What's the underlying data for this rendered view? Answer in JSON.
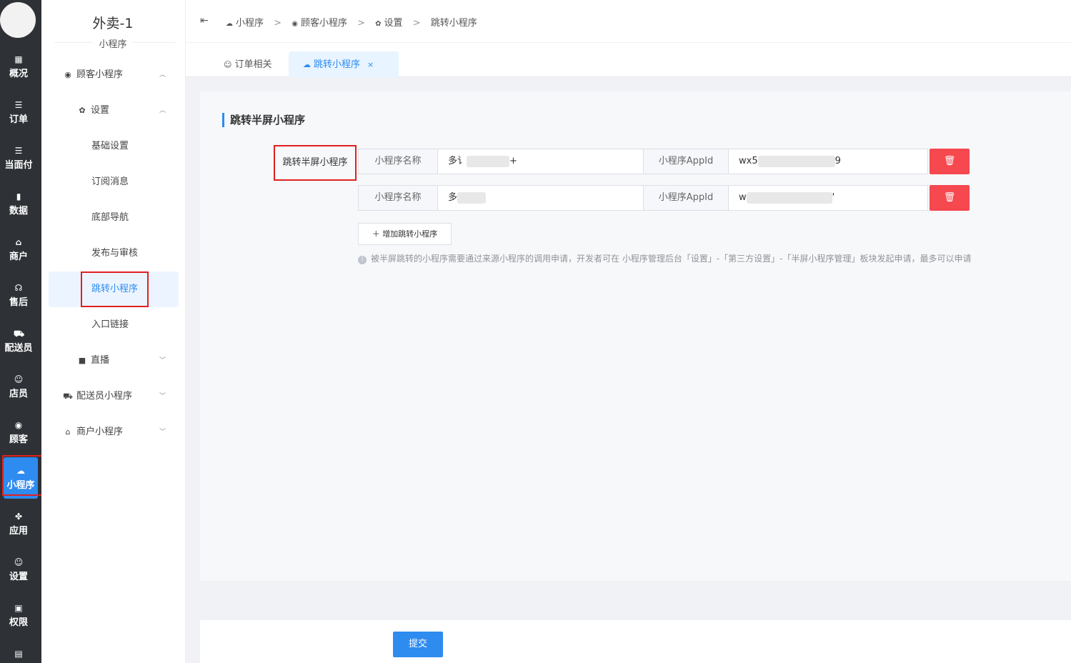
{
  "rail": {
    "items": [
      {
        "label": "概况",
        "icon": "dashboard-icon",
        "glyph": "▦"
      },
      {
        "label": "订单",
        "icon": "list-icon",
        "glyph": "☰"
      },
      {
        "label": "当面付",
        "icon": "list-icon",
        "glyph": "☰"
      },
      {
        "label": "数据",
        "icon": "bar-chart-icon",
        "glyph": "▮"
      },
      {
        "label": "商户",
        "icon": "store-icon",
        "glyph": "⌂"
      },
      {
        "label": "售后",
        "icon": "headset-icon",
        "glyph": "☊"
      },
      {
        "label": "配送员",
        "icon": "scooter-icon",
        "glyph": "⛟"
      },
      {
        "label": "店员",
        "icon": "user-icon",
        "glyph": "☺"
      },
      {
        "label": "顾客",
        "icon": "user-circle-icon",
        "glyph": "◉"
      },
      {
        "label": "小程序",
        "icon": "wechat-icon",
        "glyph": "☁"
      },
      {
        "label": "应用",
        "icon": "apps-icon",
        "glyph": "✤"
      },
      {
        "label": "设置",
        "icon": "user-gear-icon",
        "glyph": "☺"
      },
      {
        "label": "权限",
        "icon": "lock-icon",
        "glyph": "▣"
      },
      {
        "label": "",
        "icon": "report-icon",
        "glyph": "▤"
      }
    ]
  },
  "sidebar": {
    "store_name": "外卖-1",
    "subtitle": "小程序",
    "menu": [
      {
        "label": "顾客小程序",
        "glyph": "◉",
        "icon": "user-circle-icon",
        "chev": "︿"
      },
      {
        "label": "设置",
        "glyph": "✿",
        "icon": "gear-icon",
        "chev": "︿"
      },
      {
        "label": "基础设置"
      },
      {
        "label": "订阅消息"
      },
      {
        "label": "底部导航"
      },
      {
        "label": "发布与审核"
      },
      {
        "label": "跳转小程序"
      },
      {
        "label": "入口链接"
      },
      {
        "label": "直播",
        "glyph": "■",
        "icon": "video-icon",
        "chev": "﹀"
      },
      {
        "label": "配送员小程序",
        "glyph": "⛟",
        "icon": "scooter-icon",
        "chev": "﹀"
      },
      {
        "label": "商户小程序",
        "glyph": "⌂",
        "icon": "store-icon",
        "chev": "﹀"
      }
    ]
  },
  "breadcrumb": {
    "collapse_glyph": "⇤",
    "items": [
      "小程序",
      "顾客小程序",
      "设置",
      "跳转小程序"
    ],
    "separator": ">"
  },
  "tabs": [
    {
      "label": "订单相关"
    },
    {
      "label": "跳转小程序",
      "close": "×"
    }
  ],
  "form": {
    "section_title": "跳转半屏小程序",
    "field_label": "跳转半屏小程序",
    "name_label": "小程序名称",
    "appid_label": "小程序AppId",
    "rows": [
      {
        "name_prefix": "多讠",
        "name_suffix": "+",
        "appid_prefix": "wx5",
        "appid_suffix": "9"
      },
      {
        "name_prefix": "多",
        "name_suffix": "",
        "appid_prefix": "w",
        "appid_suffix": "'"
      }
    ],
    "delete_glyph": "🗑",
    "add_button": "＋ 增加跳转小程序",
    "tip": "被半屏跳转的小程序需要通过来源小程序的调用申请，开发者可在 小程序管理后台「设置」-「第三方设置」-「半屏小程序管理」板块发起申请，最多可以申请"
  },
  "footer": {
    "submit": "提交"
  },
  "colors": {
    "accent": "#2e8bf0",
    "danger": "#f5484f",
    "rail": "#2e3236",
    "highlight_box": "#e02020"
  }
}
